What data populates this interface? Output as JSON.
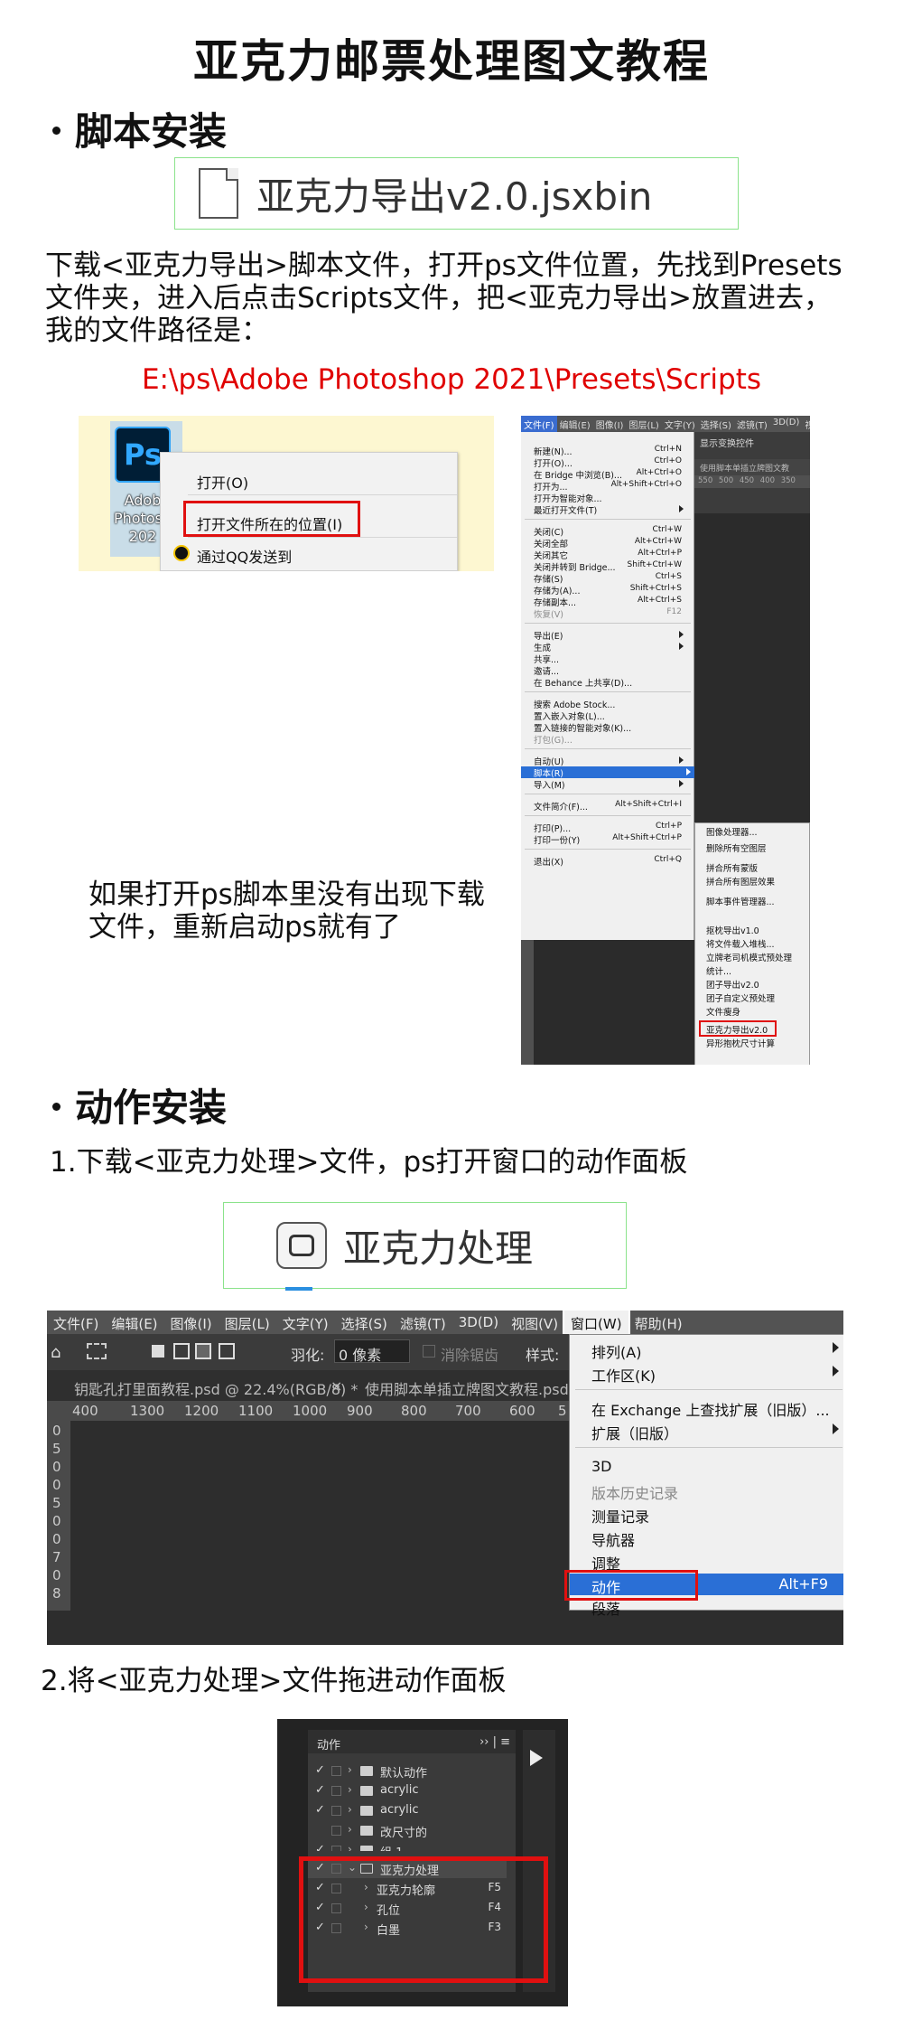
{
  "title": "亚克力邮票处理图文教程",
  "section1": {
    "heading": "脚本安装",
    "file_name": "亚克力导出v2.0.jsxbin",
    "desc_lines": [
      "下载<亚克力导出>脚本文件，打开ps文件位置，先找到Presets",
      "文件夹，进入后点击Scripts文件，把<亚克力导出>放置进去，",
      "我的文件路径是："
    ],
    "path": "E:\\ps\\Adobe Photoshop 2021\\Presets\\Scripts",
    "explorer": {
      "icon_text": "Ps",
      "icon_label": [
        "Adob",
        "Photosh",
        "202"
      ],
      "menu_open": "打开(O)",
      "menu_location": "打开文件所在的位置(I)",
      "menu_qq": "通过QQ发送到"
    },
    "note_lines": [
      "如果打开ps脚本里没有出现下载",
      "文件，重新启动ps就有了"
    ],
    "ps_menubar": [
      "文件(F)",
      "编辑(E)",
      "图像(I)",
      "图层(L)",
      "文字(Y)",
      "选择(S)",
      "滤镜(T)",
      "3D(D)",
      "视"
    ],
    "ps_right": {
      "toolbar": "显示变换控件",
      "tab": "使用脚本单插立牌图文教",
      "ruler": "550 500 450 400 350"
    },
    "file_menu": [
      {
        "label": "新建(N)...",
        "shortcut": "Ctrl+N"
      },
      {
        "label": "打开(O)...",
        "shortcut": "Ctrl+O"
      },
      {
        "label": "在 Bridge 中浏览(B)...",
        "shortcut": "Alt+Ctrl+O"
      },
      {
        "label": "打开为...",
        "shortcut": "Alt+Shift+Ctrl+O"
      },
      {
        "label": "打开为智能对象...",
        "shortcut": ""
      },
      {
        "label": "最近打开文件(T)",
        "shortcut": ""
      },
      {
        "label": "关闭(C)",
        "shortcut": "Ctrl+W"
      },
      {
        "label": "关闭全部",
        "shortcut": "Alt+Ctrl+W"
      },
      {
        "label": "关闭其它",
        "shortcut": "Alt+Ctrl+P"
      },
      {
        "label": "关闭并转到 Bridge...",
        "shortcut": "Shift+Ctrl+W"
      },
      {
        "label": "存储(S)",
        "shortcut": "Ctrl+S"
      },
      {
        "label": "存储为(A)...",
        "shortcut": "Shift+Ctrl+S"
      },
      {
        "label": "存储副本...",
        "shortcut": "Alt+Ctrl+S"
      },
      {
        "label": "恢复(V)",
        "shortcut": "F12"
      },
      {
        "label": "导出(E)",
        "shortcut": ""
      },
      {
        "label": "生成",
        "shortcut": ""
      },
      {
        "label": "共享...",
        "shortcut": ""
      },
      {
        "label": "邀请...",
        "shortcut": ""
      },
      {
        "label": "在 Behance 上共享(D)...",
        "shortcut": ""
      },
      {
        "label": "搜索 Adobe Stock...",
        "shortcut": ""
      },
      {
        "label": "置入嵌入对象(L)...",
        "shortcut": ""
      },
      {
        "label": "置入链接的智能对象(K)...",
        "shortcut": ""
      },
      {
        "label": "打包(G)...",
        "shortcut": ""
      },
      {
        "label": "自动(U)",
        "shortcut": ""
      },
      {
        "label": "脚本(R)",
        "shortcut": ""
      },
      {
        "label": "导入(M)",
        "shortcut": ""
      },
      {
        "label": "文件简介(F)...",
        "shortcut": "Alt+Shift+Ctrl+I"
      },
      {
        "label": "打印(P)...",
        "shortcut": "Ctrl+P"
      },
      {
        "label": "打印一份(Y)",
        "shortcut": "Alt+Shift+Ctrl+P"
      },
      {
        "label": "退出(X)",
        "shortcut": "Ctrl+Q"
      }
    ],
    "script_submenu": [
      "图像处理器...",
      "删除所有空图层",
      "拼合所有蒙版",
      "拼合所有图层效果",
      "脚本事件管理器...",
      "抠枕导出v1.0",
      "将文件载入堆栈...",
      "立牌老司机模式预处理",
      "统计...",
      "团子导出v2.0",
      "团子自定义预处理",
      "文件瘦身",
      "亚克力导出v2.0",
      "异形抱枕尺寸计算"
    ]
  },
  "section2": {
    "heading": "动作安装",
    "step1": "1.下载<亚克力处理>文件，ps打开窗口的动作面板",
    "file_name": "亚克力处理",
    "menubar": [
      "文件(F)",
      "编辑(E)",
      "图像(I)",
      "图层(L)",
      "文字(Y)",
      "选择(S)",
      "滤镜(T)",
      "3D(D)",
      "视图(V)",
      "窗口(W)",
      "帮助(H)"
    ],
    "options": {
      "feather_label": "羽化:",
      "feather_value": "0 像素",
      "antialias": "消除锯齿",
      "style": "样式:"
    },
    "tabs": [
      "钥匙孔打里面教程.psd @ 22.4%(RGB/8) *",
      "使用脚本单插立牌图文教程.psd"
    ],
    "ruler_h": [
      "400",
      "1300",
      "1200",
      "1100",
      "1000",
      "900",
      "800",
      "700",
      "600",
      "5"
    ],
    "ruler_v": [
      "0",
      "5",
      "0",
      "0",
      "5",
      "0",
      "0",
      "7",
      "0",
      "8"
    ],
    "window_menu": [
      "排列(A)",
      "工作区(K)",
      "在 Exchange 上查找扩展（旧版）...",
      "扩展（旧版）",
      "3D",
      "版本历史记录",
      "测量记录",
      "导航器",
      "调整",
      "动作",
      "段落"
    ],
    "window_shortcut": "Alt+F9",
    "step2": "2.将<亚克力处理>文件拖进动作面板",
    "actions_panel": {
      "title": "动作",
      "menu": "›› | ≡",
      "rows": [
        {
          "label": "默认动作",
          "key": ""
        },
        {
          "label": "acrylic",
          "key": ""
        },
        {
          "label": "acrylic",
          "key": ""
        },
        {
          "label": "改尺寸的",
          "key": ""
        },
        {
          "label": "组 1",
          "key": ""
        },
        {
          "label": "亚克力处理",
          "key": ""
        },
        {
          "label": "亚克力轮廓",
          "key": "F5"
        },
        {
          "label": "孔位",
          "key": "F4"
        },
        {
          "label": "白墨",
          "key": "F3"
        }
      ]
    }
  },
  "colors": {
    "accent_red": "#e00000",
    "file_border": "#8be38b",
    "ps_blue": "#2a6fd6"
  }
}
